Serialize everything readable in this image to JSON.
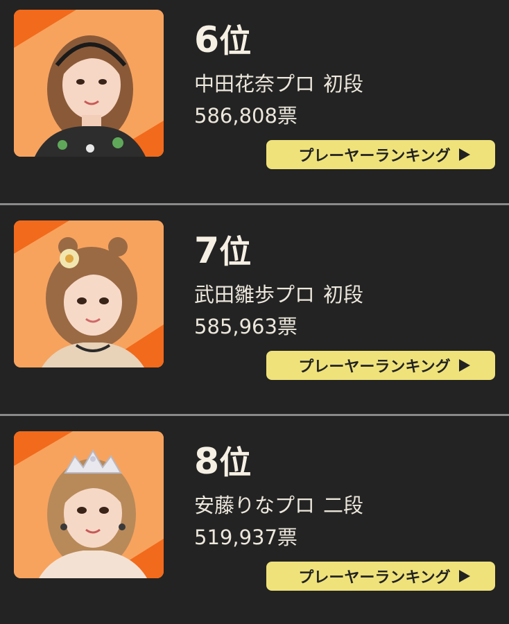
{
  "players": [
    {
      "rank_num": "6",
      "rank_suffix": "位",
      "name": "中田花奈プロ",
      "title": "初段",
      "votes": "586,808票",
      "button_label": "プレーヤーランキング",
      "button_icon": "play-triangle-icon",
      "photo_alt": "中田花奈プロ"
    },
    {
      "rank_num": "7",
      "rank_suffix": "位",
      "name": "武田雛歩プロ",
      "title": "初段",
      "votes": "585,963票",
      "button_label": "プレーヤーランキング",
      "button_icon": "play-triangle-icon",
      "photo_alt": "武田雛歩プロ"
    },
    {
      "rank_num": "8",
      "rank_suffix": "位",
      "name": "安藤りなプロ",
      "title": "二段",
      "votes": "519,937票",
      "button_label": "プレーヤーランキング",
      "button_icon": "play-triangle-icon",
      "photo_alt": "安藤りなプロ"
    }
  ],
  "colors": {
    "background": "#232323",
    "divider": "#8a8a8a",
    "button": "#efe27a",
    "photo_orange": "#f5a05c",
    "photo_stripe": "#f26a1b"
  }
}
